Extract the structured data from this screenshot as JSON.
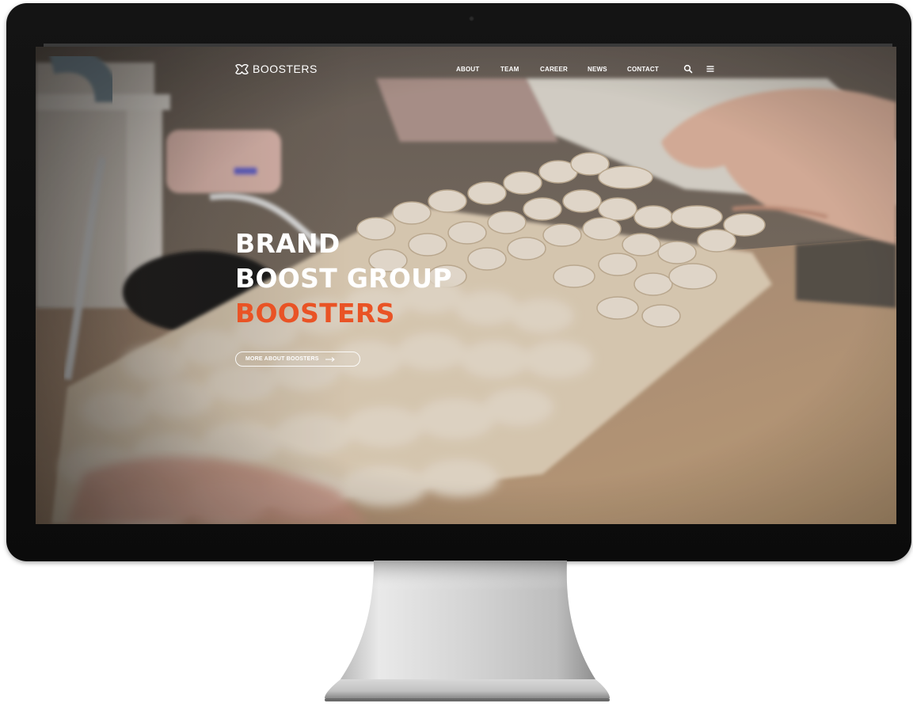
{
  "brand": {
    "logo_text": "BOOSTERS",
    "accent_color": "#e95325"
  },
  "nav": {
    "items": [
      {
        "label": "ABOUT"
      },
      {
        "label": "TEAM"
      },
      {
        "label": "CAREER"
      },
      {
        "label": "NEWS"
      },
      {
        "label": "CONTACT"
      }
    ],
    "search_icon": "search-icon",
    "menu_icon": "hamburger-menu-icon"
  },
  "hero": {
    "line1": "BRAND",
    "line2": "BOOST GROUP",
    "line3": "BOOSTERS",
    "cta_label": "MORE ABOUT BOOSTERS",
    "cta_icon": "arrow-right-icon",
    "background": "keyboard-photo"
  }
}
